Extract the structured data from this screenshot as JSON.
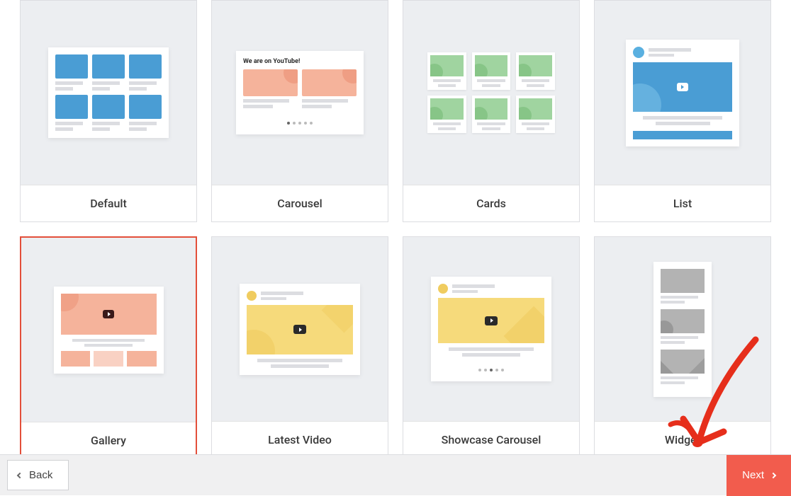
{
  "templates": [
    {
      "id": "default",
      "label": "Default",
      "selected": false
    },
    {
      "id": "carousel",
      "label": "Carousel",
      "selected": false
    },
    {
      "id": "cards",
      "label": "Cards",
      "selected": false
    },
    {
      "id": "list",
      "label": "List",
      "selected": false
    },
    {
      "id": "gallery",
      "label": "Gallery",
      "selected": true
    },
    {
      "id": "latest",
      "label": "Latest Video",
      "selected": false
    },
    {
      "id": "showcase",
      "label": "Showcase Carousel",
      "selected": false
    },
    {
      "id": "widget",
      "label": "Widget",
      "selected": false
    }
  ],
  "carousel_preview_title": "We are on YouTube!",
  "footer": {
    "back_label": "Back",
    "next_label": "Next"
  },
  "colors": {
    "accent": "#f25c4d",
    "selected_border": "#e34f3a",
    "blue": "#4a9dd4",
    "salmon": "#f5b39b",
    "green": "#a0d4a0",
    "yellow": "#f6da7b",
    "grey": "#b3b3b3"
  }
}
